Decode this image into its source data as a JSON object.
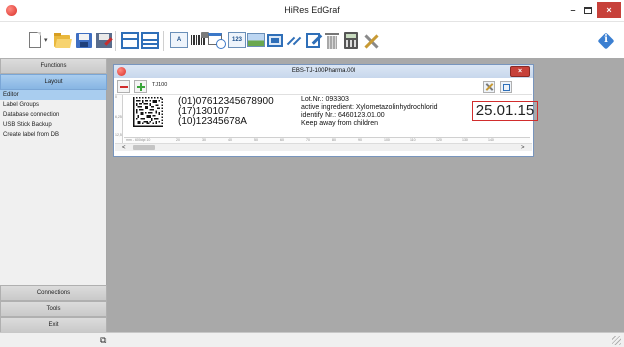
{
  "window": {
    "title": "HiRes EdGraf",
    "minimize": "–",
    "close": "×"
  },
  "toolbar": {
    "icons": [
      "new-document-icon",
      "new-dropdown-icon",
      "open-folder-icon",
      "save-icon",
      "save-as-icon",
      "single-frame-icon",
      "double-frame-icon",
      "text-field-icon",
      "barcode-icon",
      "date-field-icon",
      "counter-field-icon",
      "image-field-icon",
      "rectangle-icon",
      "line-icon",
      "edit-icon",
      "trash-icon",
      "calculator-icon",
      "tools-icon",
      "info-icon"
    ],
    "dropdown_glyph": "▾",
    "text_icon_glyph": "A",
    "counter_icon_glyph": "123",
    "info_glyph": "i"
  },
  "sidebar": {
    "functions": "Functions",
    "layout": "Layout",
    "items": [
      "Editor",
      "Label Groups",
      "Database connection",
      "USB Stick Backup",
      "Create label from DB"
    ],
    "selected_index": 0,
    "connections": "Connections",
    "tools": "Tools",
    "exit": "Exit"
  },
  "document": {
    "title": "EBS-TJ-100Pharma.00l",
    "close": "×",
    "toolbar_label": "TJ100",
    "vruler": [
      "0",
      "6,25",
      "12,5"
    ],
    "hruler": [
      "mm - 600dpi 10",
      "20",
      "30",
      "40",
      "50",
      "60",
      "70",
      "80",
      "90",
      "100",
      "110",
      "120",
      "130",
      "140"
    ],
    "label": {
      "ai_lines": [
        "(01)07612345678900",
        "(17)130107",
        "(10)12345678A"
      ],
      "lot_lines": [
        "Lot.Nr.: 093303",
        "active ingredient: Xylometazolinhydrochlorid",
        "identify Nr.: 6460123.01.00",
        "Keep away from children"
      ],
      "date": "25.01.15"
    },
    "scroll_left": "<",
    "scroll_right": ">"
  },
  "statusbar": {
    "icon": "network-icon",
    "glyph": "⧉"
  },
  "colors": {
    "accent_blue": "#a9cdef",
    "workspace_gray": "#a9a9a9",
    "close_red": "#c7413a",
    "date_border": "#d12d2d"
  }
}
